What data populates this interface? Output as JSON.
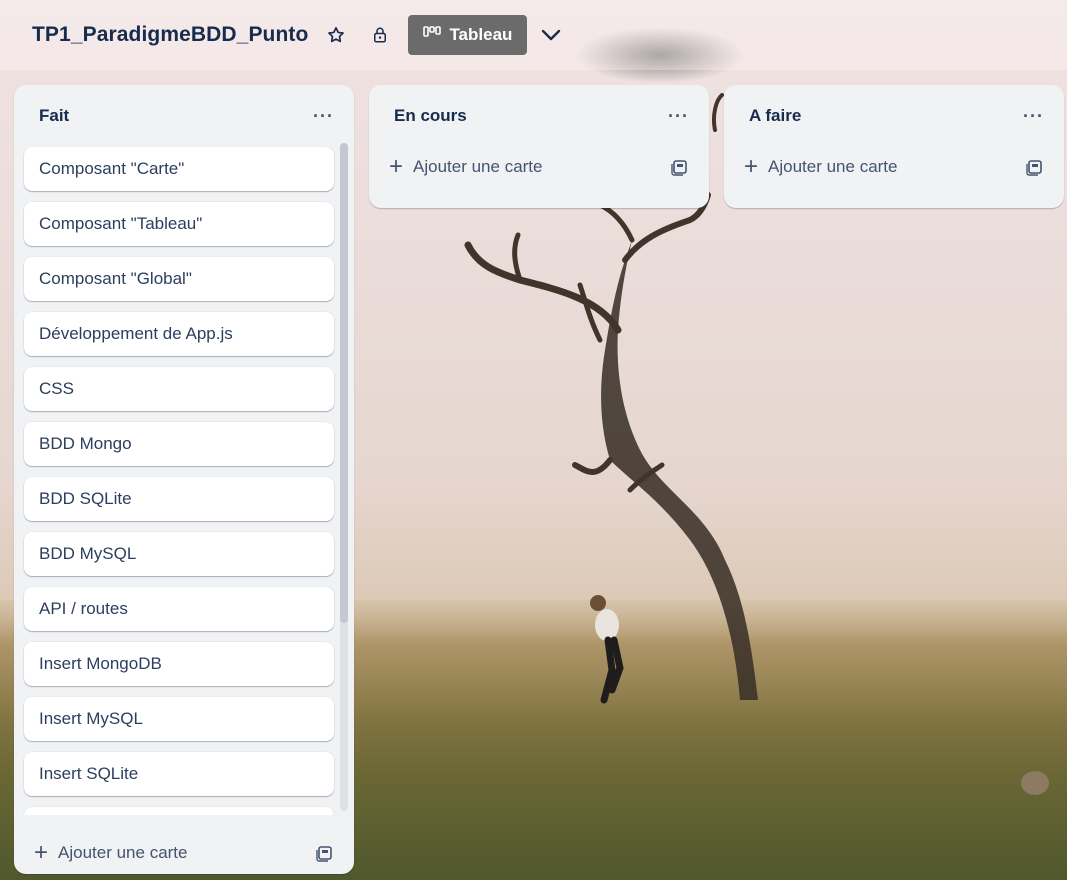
{
  "header": {
    "board_title": "TP1_ParadigmeBDD_Punto",
    "view_label": "Tableau",
    "icons": [
      "star-icon",
      "lock-icon",
      "board-view-icon",
      "chevron-down-icon"
    ]
  },
  "lists": [
    {
      "title": "Fait",
      "cards": [
        "Composant \"Carte\"",
        "Composant \"Tableau\"",
        "Composant \"Global\"",
        "Développement de App.js",
        "CSS",
        "BDD Mongo",
        "BDD SQLite",
        "BDD MySQL",
        "API / routes",
        "Insert MongoDB",
        "Insert MySQL",
        "Insert SQLite"
      ],
      "add_card_label": "Ajouter une carte"
    },
    {
      "title": "En cours",
      "cards": [],
      "add_card_label": "Ajouter une carte"
    },
    {
      "title": "A faire",
      "cards": [],
      "add_card_label": "Ajouter une carte"
    }
  ],
  "colors": {
    "view_button_bg": "#6b6b6b",
    "list_bg": "#f1f2f4",
    "text": "#172b4d"
  }
}
